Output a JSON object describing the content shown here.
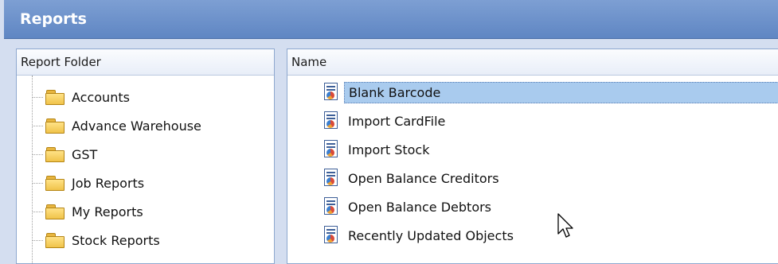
{
  "window": {
    "title": "Reports"
  },
  "left_panel": {
    "header": "Report Folder",
    "folders": [
      {
        "label": "Accounts"
      },
      {
        "label": "Advance Warehouse"
      },
      {
        "label": "GST"
      },
      {
        "label": "Job Reports"
      },
      {
        "label": "My Reports"
      },
      {
        "label": "Stock Reports"
      }
    ]
  },
  "right_panel": {
    "header": "Name",
    "reports": [
      {
        "label": "Blank Barcode",
        "selected": true
      },
      {
        "label": "Import CardFile",
        "selected": false
      },
      {
        "label": "Import Stock",
        "selected": false
      },
      {
        "label": "Open Balance Creditors",
        "selected": false
      },
      {
        "label": "Open Balance Debtors",
        "selected": false
      },
      {
        "label": "Recently Updated Objects",
        "selected": false
      }
    ]
  },
  "colors": {
    "title_bar": "#6a8fcb",
    "selection": "#a9cbee",
    "folder": "#f0c34a"
  },
  "icons": {
    "folder": "folder-icon",
    "report": "report-chart-icon",
    "cursor": "mouse-pointer-icon"
  }
}
